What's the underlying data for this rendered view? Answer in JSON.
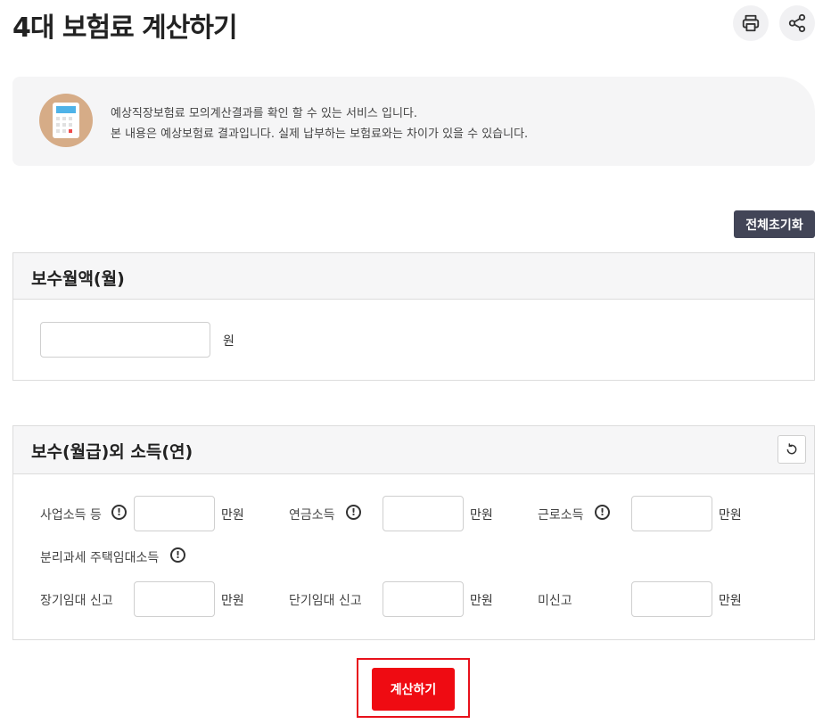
{
  "header": {
    "title": "4대 보험료 계산하기",
    "print_icon": "printer-icon",
    "share_icon": "share-icon"
  },
  "info": {
    "icon": "calculator-icon",
    "line1": "예상직장보험료 모의계산결과를 확인 할 수 있는 서비스 입니다.",
    "line2": "본 내용은 예상보험료 결과입니다. 실제 납부하는 보험료와는 차이가 있을 수 있습니다."
  },
  "reset_all_label": "전체초기화",
  "monthly_pay": {
    "title": "보수월액(월)",
    "input_value": "",
    "unit": "원"
  },
  "other_income": {
    "title": "보수(월급)외 소득(연)",
    "refresh_icon": "refresh-icon",
    "info_glyph": "!",
    "row1": [
      {
        "label": "사업소득 등",
        "value": "",
        "unit": "만원"
      },
      {
        "label": "연금소득",
        "value": "",
        "unit": "만원"
      },
      {
        "label": "근로소득",
        "value": "",
        "unit": "만원"
      }
    ],
    "separate_tax_label": "분리과세 주택임대소득",
    "row2": [
      {
        "label": "장기임대 신고",
        "value": "",
        "unit": "만원"
      },
      {
        "label": "단기임대 신고",
        "value": "",
        "unit": "만원"
      },
      {
        "label": "미신고",
        "value": "",
        "unit": "만원"
      }
    ]
  },
  "calculate_label": "계산하기",
  "colors": {
    "accent": "#ef0b12",
    "dark_button": "#424557",
    "info_bg": "#f5f5f6",
    "avatar": "#d6ac87"
  }
}
